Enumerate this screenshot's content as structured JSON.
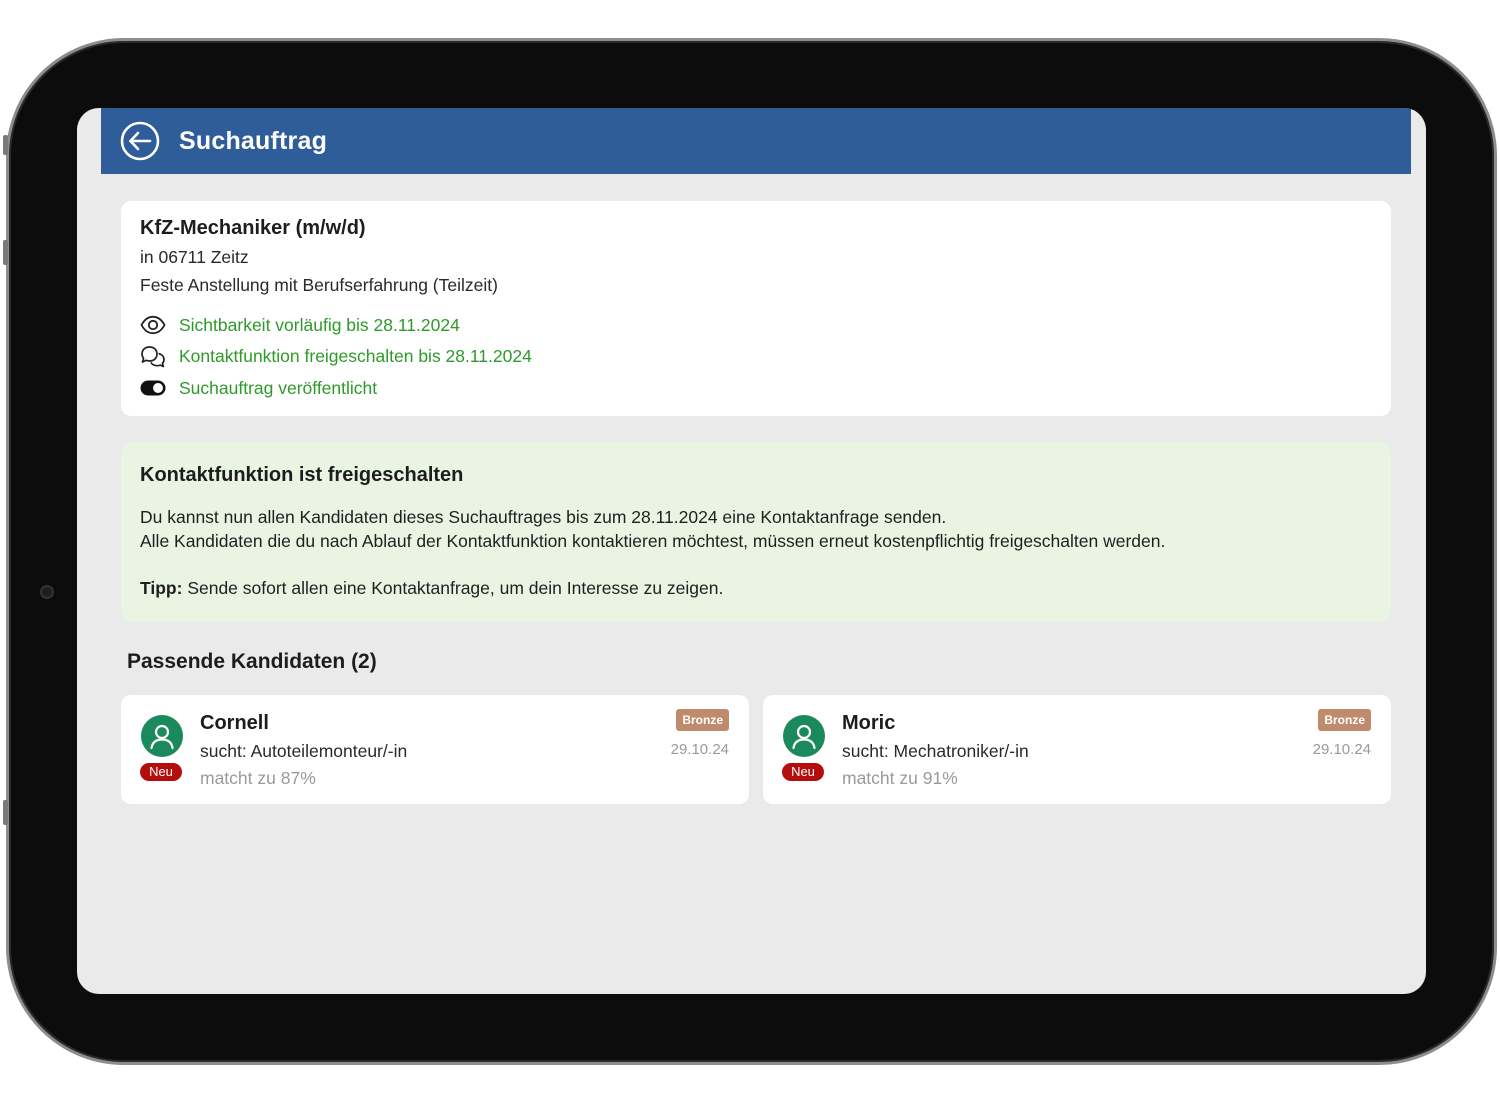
{
  "header": {
    "title": "Suchauftrag",
    "back_icon": "arrow-left-circle-icon"
  },
  "job": {
    "title": "KfZ-Mechaniker (m/w/d)",
    "location": "in 06711 Zeitz",
    "employment": "Feste Anstellung mit Berufserfahrung (Teilzeit)",
    "status_items": [
      {
        "icon": "eye-icon",
        "label": "Sichtbarkeit vorläufig bis 28.11.2024"
      },
      {
        "icon": "chat-bubbles-icon",
        "label": "Kontaktfunktion freigeschalten bis 28.11.2024"
      },
      {
        "icon": "toggle-on-icon",
        "label": "Suchauftrag veröffentlicht"
      }
    ]
  },
  "info": {
    "title": "Kontaktfunktion ist freigeschalten",
    "line1": "Du kannst nun allen Kandidaten dieses Suchauftrages bis zum 28.11.2024 eine Kontaktanfrage senden.",
    "line2": "Alle Kandidaten die du nach Ablauf der Kontaktfunktion kontaktieren möchtest, müssen erneut kostenpflichtig freigeschalten werden.",
    "tip_label": "Tipp:",
    "tip_text": " Sende sofort allen eine Kontaktanfrage, um dein Interesse zu zeigen."
  },
  "candidates": {
    "section_title": "Passende Kandidaten (2)",
    "items": [
      {
        "name": "Cornell",
        "seeks": "sucht: Autoteilemonteur/-in",
        "match": "matcht zu 87%",
        "badge": "Neu",
        "level": "Bronze",
        "date": "29.10.24",
        "avatar_icon": "user-avatar-icon"
      },
      {
        "name": "Moric",
        "seeks": "sucht: Mechatroniker/-in",
        "match": "matcht zu 91%",
        "badge": "Neu",
        "level": "Bronze",
        "date": "29.10.24",
        "avatar_icon": "user-avatar-icon"
      }
    ]
  },
  "colors": {
    "appbar": "#2f5d99",
    "status_green": "#2e9a2a",
    "info_bg": "#e9f4e3",
    "avatar_green": "#1a8a5c",
    "new_badge_red": "#b40d0d",
    "bronze": "#c08a6d"
  }
}
